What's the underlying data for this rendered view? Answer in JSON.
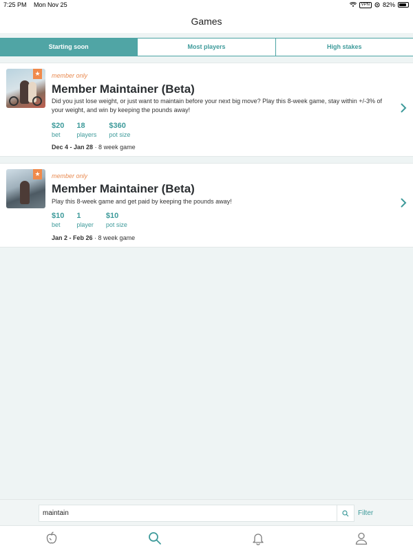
{
  "status": {
    "time": "7:25 PM",
    "date": "Mon Nov 25",
    "vpn": "VPN",
    "battery": "82%",
    "battery_level": 0.82
  },
  "nav": {
    "title": "Games"
  },
  "tabs": [
    {
      "label": "Starting soon",
      "active": true
    },
    {
      "label": "Most players",
      "active": false
    },
    {
      "label": "High stakes",
      "active": false
    }
  ],
  "games": [
    {
      "badge": "member only",
      "title": "Member Maintainer (Beta)",
      "description": "Did you just lose weight, or just want to maintain before your next big move? Play this 8-week game, stay within +/-3% of your weight, and win by keeping the pounds away!",
      "bet_value": "$20",
      "bet_label": "bet",
      "players_value": "18",
      "players_label": "players",
      "pot_value": "$360",
      "pot_label": "pot size",
      "dates": "Dec 4 - Jan 28",
      "duration": "· 8 week game"
    },
    {
      "badge": "member only",
      "title": "Member Maintainer (Beta)",
      "description": "Play this 8-week game and get paid by keeping the pounds away!",
      "bet_value": "$10",
      "bet_label": "bet",
      "players_value": "1",
      "players_label": "player",
      "pot_value": "$10",
      "pot_label": "pot size",
      "dates": "Jan 2 - Feb 26",
      "duration": "· 8 week game"
    }
  ],
  "search": {
    "value": "maintain",
    "filter_label": "Filter"
  },
  "colors": {
    "accent": "#50a5a5",
    "member": "#e8894f"
  },
  "tabbar": {
    "items": [
      "apple-icon",
      "search-icon",
      "bell-icon",
      "profile-icon"
    ]
  }
}
